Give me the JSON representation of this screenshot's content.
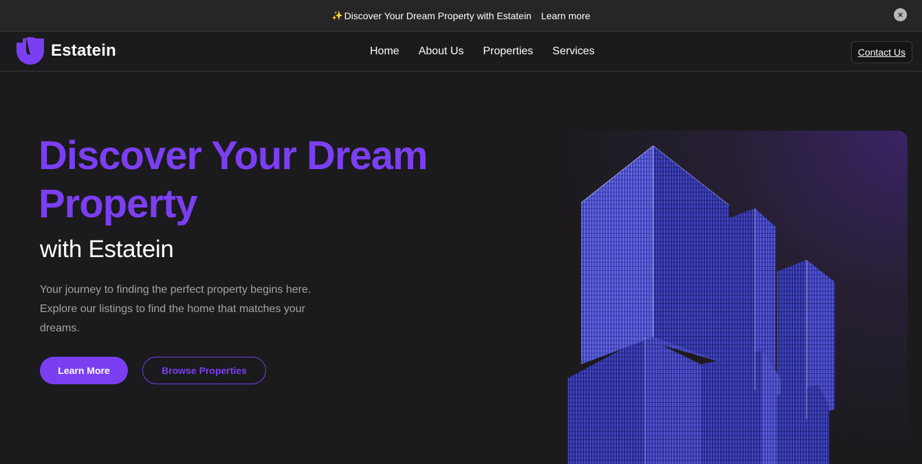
{
  "announcement": {
    "sparkle": "✨",
    "message": "Discover Your Dream Property with Estatein",
    "link_label": "Learn more",
    "close_symbol": "×"
  },
  "header": {
    "brand": "Estatein",
    "nav": [
      "Home",
      "About Us",
      "Properties",
      "Services"
    ],
    "contact_label": "Contact Us"
  },
  "hero": {
    "title": "Discover Your Dream Property",
    "subtitle": "with Estatein",
    "description": "Your journey to finding the perfect property begins here. Explore our listings to find the home that matches your dreams.",
    "primary_button": "Learn More",
    "secondary_button": "Browse Properties",
    "image_icon": "building-image"
  },
  "colors": {
    "accent": "#7b3ff2",
    "background": "#1b1a1c",
    "bar": "#262527",
    "muted_text": "#a3a3a5"
  }
}
